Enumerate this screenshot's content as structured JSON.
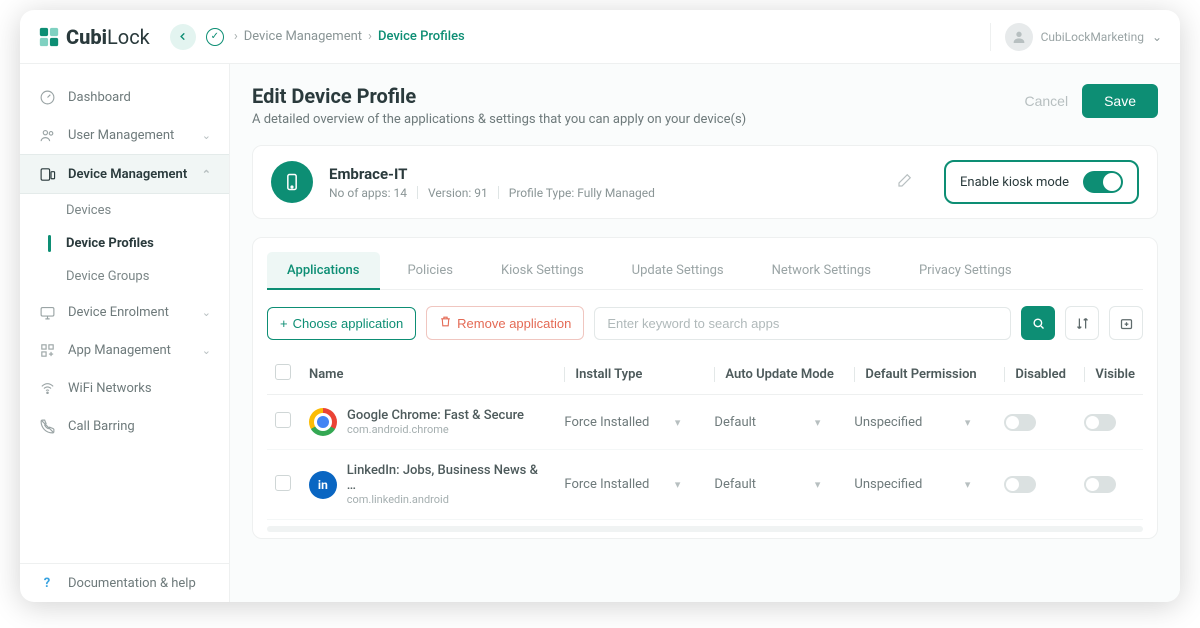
{
  "brand": {
    "part1": "Cubi",
    "part2": "Lock"
  },
  "user": {
    "name": "CubiLockMarketing"
  },
  "breadcrumb": {
    "level1": "Device Management",
    "level2": "Device Profiles"
  },
  "sidebar": {
    "items": [
      {
        "label": "Dashboard"
      },
      {
        "label": "User Management"
      },
      {
        "label": "Device Management"
      },
      {
        "label": "Device Enrolment"
      },
      {
        "label": "App Management"
      },
      {
        "label": "WiFi Networks"
      },
      {
        "label": "Call Barring"
      },
      {
        "label": "Documentation & help"
      }
    ],
    "sub": [
      {
        "label": "Devices"
      },
      {
        "label": "Device Profiles"
      },
      {
        "label": "Device Groups"
      }
    ]
  },
  "page": {
    "title": "Edit Device Profile",
    "desc": "A detailed overview of the applications & settings that you can apply on your device(s)",
    "cancel": "Cancel",
    "save": "Save"
  },
  "profile": {
    "name": "Embrace-IT",
    "apps_label": "No of apps:",
    "apps": "14",
    "version_label": "Version:",
    "version": "91",
    "type_label": "Profile Type:",
    "type": "Fully Managed",
    "kiosk_label": "Enable kiosk mode"
  },
  "tabs": [
    "Applications",
    "Policies",
    "Kiosk Settings",
    "Update Settings",
    "Network Settings",
    "Privacy Settings"
  ],
  "toolbar": {
    "choose": "Choose application",
    "remove": "Remove application",
    "search_placeholder": "Enter keyword to search apps"
  },
  "columns": {
    "name": "Name",
    "install": "Install Type",
    "update": "Auto Update Mode",
    "permission": "Default Permission",
    "disabled": "Disabled",
    "visible": "Visible"
  },
  "rows": [
    {
      "icon": "chrome",
      "name": "Google Chrome: Fast & Secure",
      "pkg": "com.android.chrome",
      "install": "Force Installed",
      "update": "Default",
      "permission": "Unspecified"
    },
    {
      "icon": "linkedin",
      "name": "LinkedIn: Jobs, Business News & …",
      "pkg": "com.linkedin.android",
      "install": "Force Installed",
      "update": "Default",
      "permission": "Unspecified"
    }
  ]
}
